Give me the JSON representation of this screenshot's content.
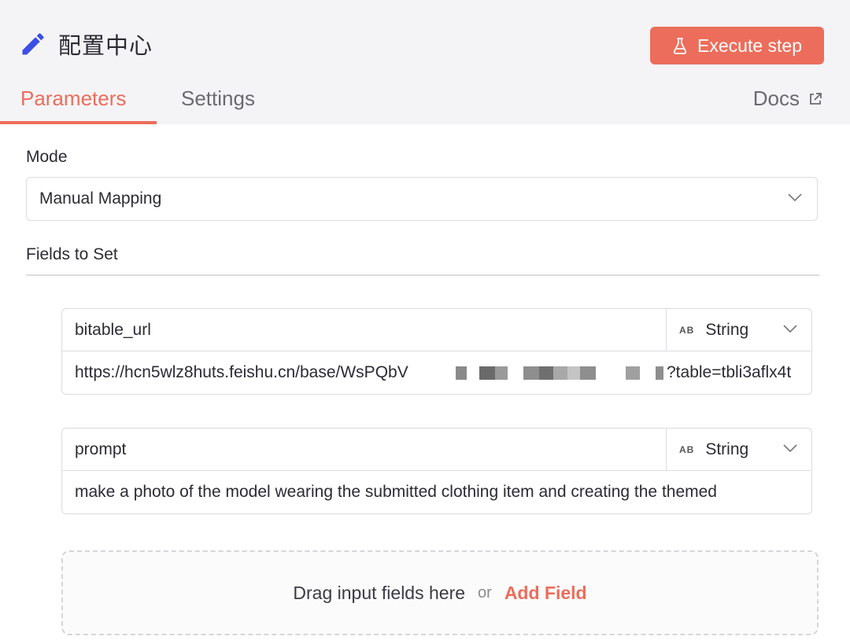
{
  "header": {
    "title": "配置中心",
    "execute_label": "Execute step"
  },
  "tabs": [
    {
      "label": "Parameters",
      "active": true
    },
    {
      "label": "Settings",
      "active": false
    }
  ],
  "docs_label": "Docs",
  "mode": {
    "label": "Mode",
    "selected": "Manual Mapping"
  },
  "fields_section": {
    "label": "Fields to Set",
    "fields": [
      {
        "name": "bitable_url",
        "type": "String",
        "type_badge": "AB",
        "value_prefix": "https://hcn5wlz8huts.feishu.cn/base/WsPQbV",
        "value_suffix": "?table=tbli3aflx4t"
      },
      {
        "name": "prompt",
        "type": "String",
        "type_badge": "AB",
        "value": "make a photo of the model wearing the submitted clothing item and creating the themed"
      }
    ]
  },
  "dropzone": {
    "drag_text": "Drag input fields here",
    "or_text": "or",
    "add_label": "Add Field"
  },
  "colors": {
    "accent": "#ec6d5b",
    "header_bg": "#f4f4f7",
    "border": "#dcdce0",
    "pencil": "#3b4ee8"
  }
}
